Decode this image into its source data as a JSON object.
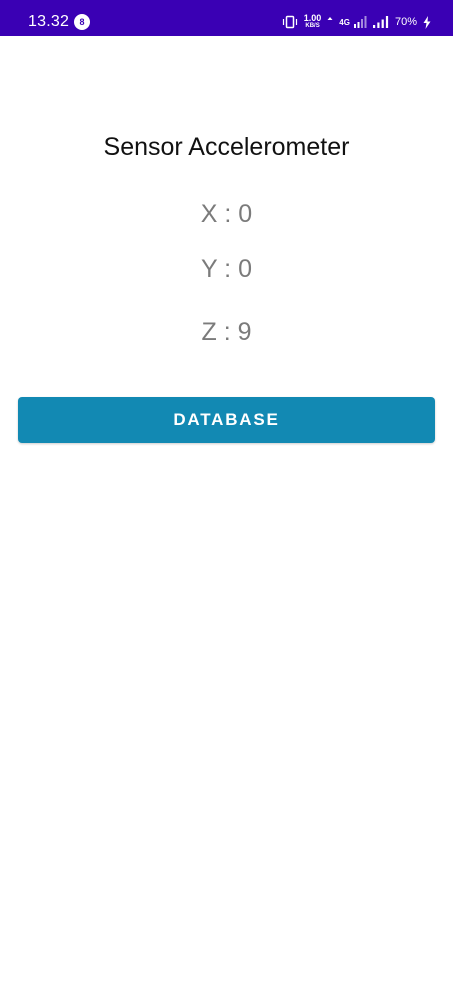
{
  "status_bar": {
    "time": "13.32",
    "notification_count": "8",
    "net_speed_value": "1.00",
    "net_speed_unit": "KB/S",
    "network_type": "4G",
    "battery_percent": "70%",
    "icons": [
      "vibrate-icon",
      "data-arrows-icon",
      "signal-icon",
      "signal-icon",
      "charging-icon"
    ],
    "background_color": "#3a00b4"
  },
  "main": {
    "title": "Sensor Accelerometer",
    "x_label": "X : 0",
    "y_label": "Y : 0",
    "z_label": "Z : 9"
  },
  "button": {
    "label": "DATABASE",
    "color": "#1289b3"
  }
}
